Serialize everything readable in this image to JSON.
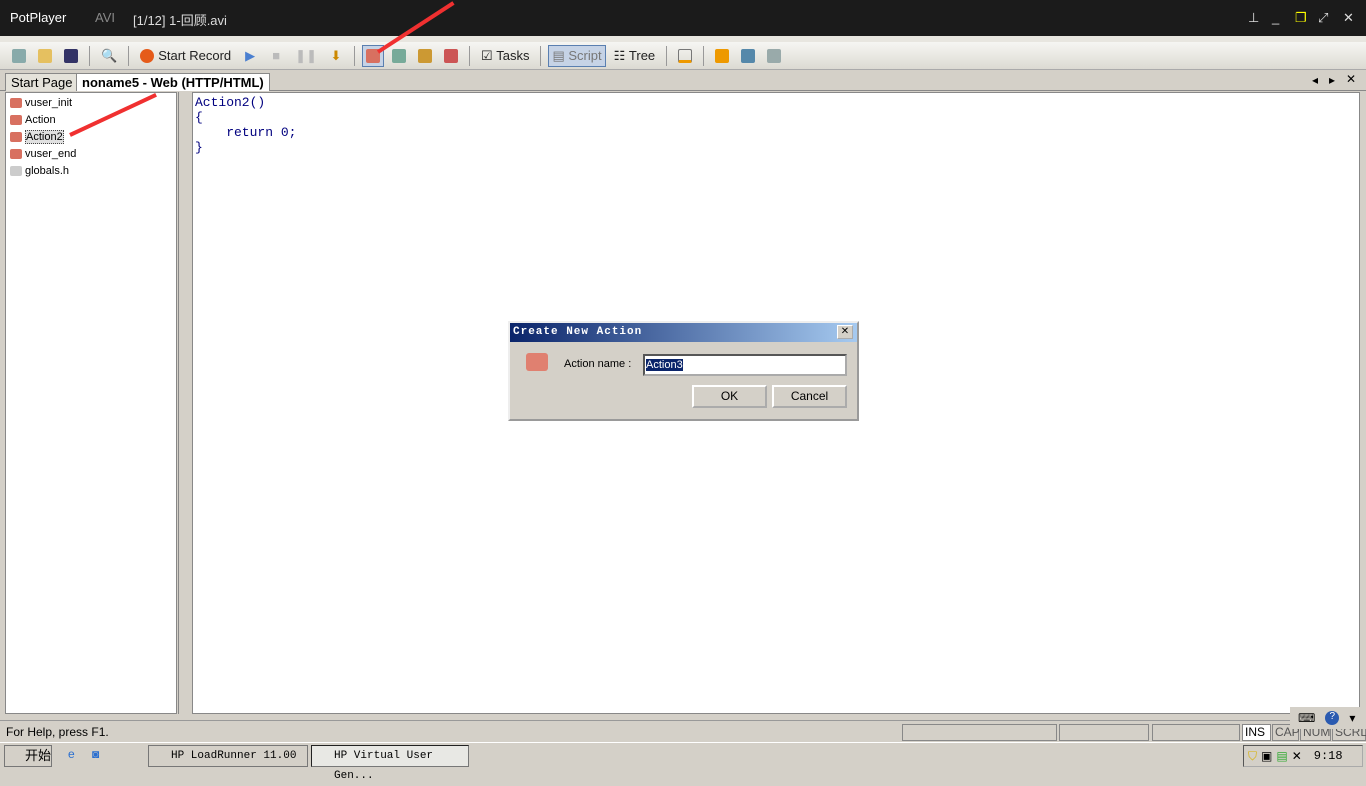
{
  "player": {
    "app": "PotPlayer",
    "format": "AVI",
    "file": "[1/12] 1-回顾.avi"
  },
  "toolbar": {
    "start_record": "Start Record",
    "tasks": "Tasks",
    "script": "Script",
    "tree": "Tree"
  },
  "tabs": [
    "Start Page",
    "noname5 - Web (HTTP/HTML)"
  ],
  "tree": [
    "vuser_init",
    "Action",
    "Action2",
    "vuser_end",
    "globals.h"
  ],
  "editor": {
    "code": "Action2()\n{\n    return 0;\n}"
  },
  "dialog": {
    "title": "Create New Action",
    "label": "Action name :",
    "value": "Action3",
    "ok": "OK",
    "cancel": "Cancel"
  },
  "status": {
    "help": "For Help, press F1.",
    "ins": "INS",
    "cap": "CAP",
    "num": "NUM",
    "scrl": "SCRL"
  },
  "taskbar": {
    "start": "开始",
    "tasks": [
      "HP LoadRunner 11.00",
      "HP Virtual User Gen..."
    ],
    "clock": "9:18"
  }
}
